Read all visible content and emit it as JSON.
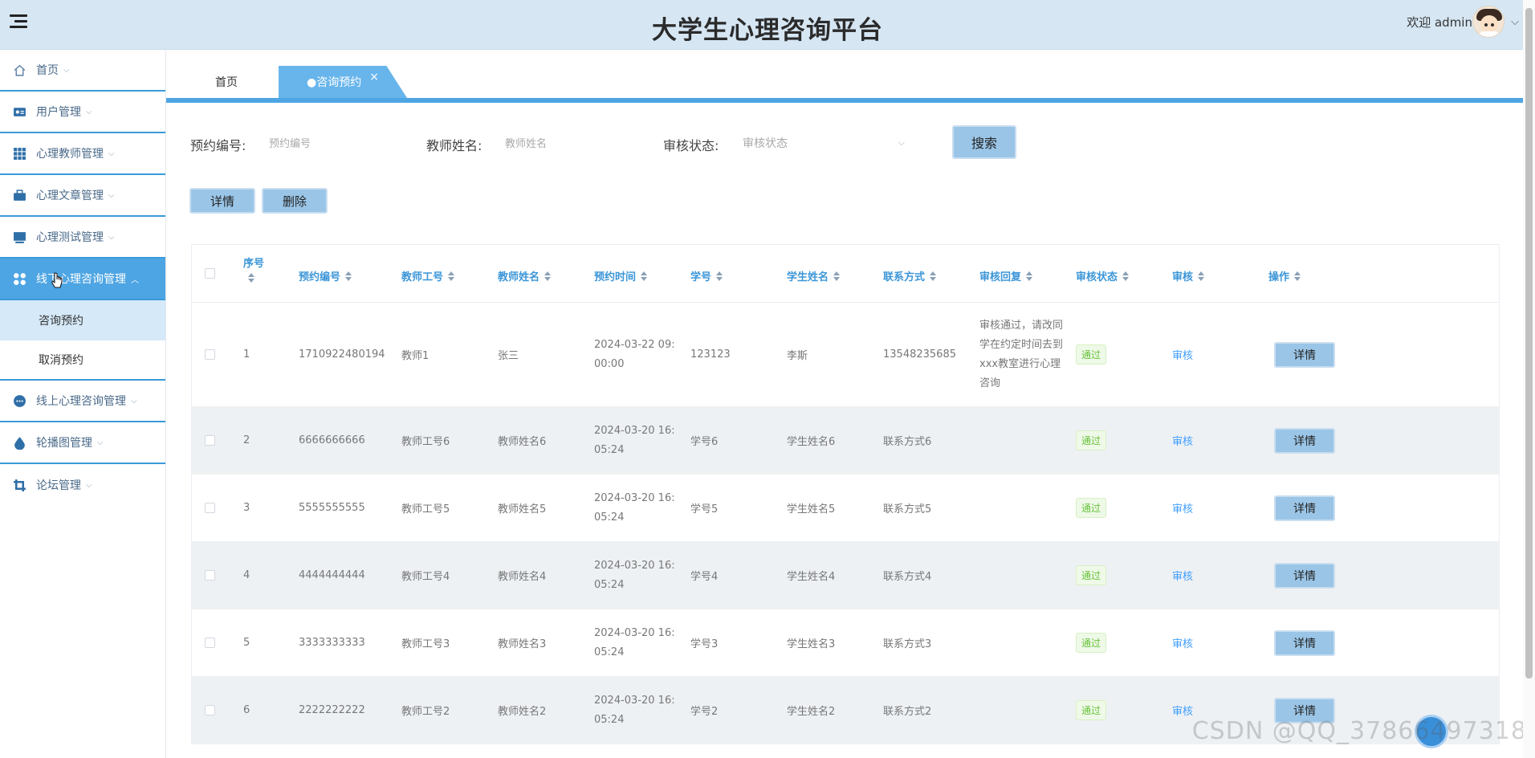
{
  "app": {
    "title": "大学生心理咨询平台",
    "welcome": "欢迎 admin"
  },
  "sidebar": {
    "items": [
      {
        "label": "首页",
        "icon": "home-icon"
      },
      {
        "label": "用户管理",
        "icon": "user-card-icon"
      },
      {
        "label": "心理教师管理",
        "icon": "grid-icon"
      },
      {
        "label": "心理文章管理",
        "icon": "briefcase-icon"
      },
      {
        "label": "心理测试管理",
        "icon": "monitor-icon"
      },
      {
        "label": "线下心理咨询管理",
        "icon": "apps-icon"
      },
      {
        "label": "线上心理咨询管理",
        "icon": "chat-icon"
      },
      {
        "label": "轮播图管理",
        "icon": "drop-icon"
      },
      {
        "label": "论坛管理",
        "icon": "crop-icon"
      }
    ],
    "sub_items": [
      "咨询预约",
      "取消预约"
    ]
  },
  "tabs": {
    "home": "首页",
    "active": "●咨询预约",
    "close": "×"
  },
  "search": {
    "booking_no_label": "预约编号:",
    "booking_no_placeholder": "预约编号",
    "teacher_name_label": "教师姓名:",
    "teacher_name_placeholder": "教师姓名",
    "status_label": "审核状态:",
    "status_placeholder": "审核状态",
    "search_button": "搜索"
  },
  "actions": {
    "detail": "详情",
    "delete": "删除"
  },
  "table": {
    "headers": [
      "序号",
      "预约编号",
      "教师工号",
      "教师姓名",
      "预约时间",
      "学号",
      "学生姓名",
      "联系方式",
      "审核回复",
      "审核状态",
      "审核",
      "操作"
    ],
    "rows": [
      {
        "no": "1",
        "booking_no": "1710922480194",
        "teacher_id": "教师1",
        "teacher_name": "张三",
        "time_line1": "2024-03-22 09:",
        "time_line2": "00:00",
        "student_id": "123123",
        "student_name": "李斯",
        "contact": "13548235685",
        "reply": "审核通过，请改同学在约定时间去到xxx教室进行心理咨询",
        "status": "通过",
        "audit": "审核",
        "op": "详情"
      },
      {
        "no": "2",
        "booking_no": "6666666666",
        "teacher_id": "教师工号6",
        "teacher_name": "教师姓名6",
        "time_line1": "2024-03-20 16:",
        "time_line2": "05:24",
        "student_id": "学号6",
        "student_name": "学生姓名6",
        "contact": "联系方式6",
        "reply": "",
        "status": "通过",
        "audit": "审核",
        "op": "详情"
      },
      {
        "no": "3",
        "booking_no": "5555555555",
        "teacher_id": "教师工号5",
        "teacher_name": "教师姓名5",
        "time_line1": "2024-03-20 16:",
        "time_line2": "05:24",
        "student_id": "学号5",
        "student_name": "学生姓名5",
        "contact": "联系方式5",
        "reply": "",
        "status": "通过",
        "audit": "审核",
        "op": "详情"
      },
      {
        "no": "4",
        "booking_no": "4444444444",
        "teacher_id": "教师工号4",
        "teacher_name": "教师姓名4",
        "time_line1": "2024-03-20 16:",
        "time_line2": "05:24",
        "student_id": "学号4",
        "student_name": "学生姓名4",
        "contact": "联系方式4",
        "reply": "",
        "status": "通过",
        "audit": "审核",
        "op": "详情"
      },
      {
        "no": "5",
        "booking_no": "3333333333",
        "teacher_id": "教师工号3",
        "teacher_name": "教师姓名3",
        "time_line1": "2024-03-20 16:",
        "time_line2": "05:24",
        "student_id": "学号3",
        "student_name": "学生姓名3",
        "contact": "联系方式3",
        "reply": "",
        "status": "通过",
        "audit": "审核",
        "op": "详情"
      },
      {
        "no": "6",
        "booking_no": "2222222222",
        "teacher_id": "教师工号2",
        "teacher_name": "教师姓名2",
        "time_line1": "2024-03-20 16:",
        "time_line2": "05:24",
        "student_id": "学号2",
        "student_name": "学生姓名2",
        "contact": "联系方式2",
        "reply": "",
        "status": "通过",
        "audit": "审核",
        "op": "详情"
      }
    ]
  },
  "watermark": "CSDN @QQ_37866497318",
  "colors": {
    "topbar": "#d6e6f3",
    "accent": "#4ea5e3",
    "header_text": "#3c96d8",
    "button": "#9ac5e7",
    "success": "#67c23a"
  }
}
